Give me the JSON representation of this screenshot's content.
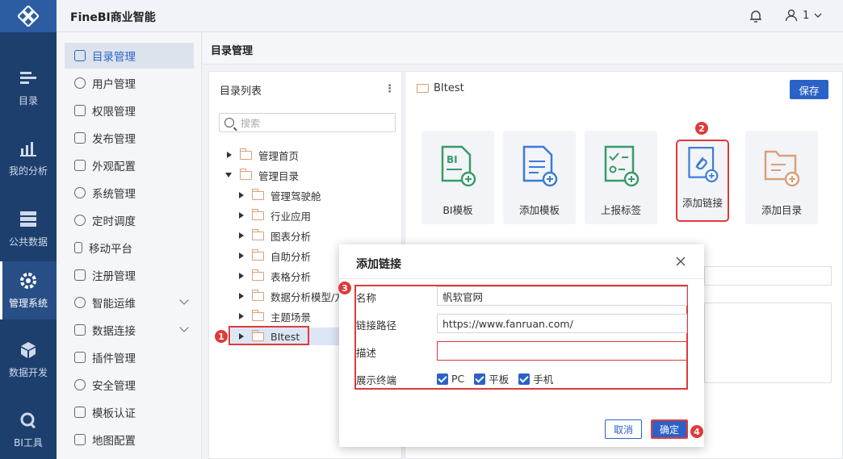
{
  "app": {
    "title": "FineBI商业智能",
    "user": "1"
  },
  "rail": [
    {
      "label": "目录",
      "icon": "catalog-icon"
    },
    {
      "label": "我的分析",
      "icon": "analysis-icon"
    },
    {
      "label": "公共数据",
      "icon": "data-icon"
    },
    {
      "label": "管理系统",
      "icon": "gear-icon",
      "active": true
    },
    {
      "label": "数据开发",
      "icon": "cube-icon"
    },
    {
      "label": "BI工具",
      "icon": "tool-icon"
    }
  ],
  "menu": [
    {
      "label": "目录管理",
      "active": true
    },
    {
      "label": "用户管理"
    },
    {
      "label": "权限管理"
    },
    {
      "label": "发布管理"
    },
    {
      "label": "外观配置"
    },
    {
      "label": "系统管理"
    },
    {
      "label": "定时调度"
    },
    {
      "label": "移动平台"
    },
    {
      "label": "注册管理"
    },
    {
      "label": "智能运维",
      "expandable": true
    },
    {
      "label": "数据连接",
      "expandable": true
    },
    {
      "label": "插件管理"
    },
    {
      "label": "安全管理"
    },
    {
      "label": "模板认证"
    },
    {
      "label": "地图配置"
    }
  ],
  "content": {
    "title": "目录管理",
    "list_title": "目录列表",
    "more": "⋮",
    "search_placeholder": "搜索",
    "tree": [
      {
        "label": "管理首页",
        "level": 0,
        "expanded": false
      },
      {
        "label": "管理目录",
        "level": 0,
        "expanded": true
      },
      {
        "label": "管理驾驶舱",
        "level": 1
      },
      {
        "label": "行业应用",
        "level": 1
      },
      {
        "label": "图表分析",
        "level": 1
      },
      {
        "label": "自助分析",
        "level": 1
      },
      {
        "label": "表格分析",
        "level": 1
      },
      {
        "label": "数据分析模型/方",
        "level": 1
      },
      {
        "label": "主题场景",
        "level": 1
      },
      {
        "label": "BItest",
        "level": 1,
        "selected": true
      }
    ],
    "selected_folder": "BItest",
    "save_label": "保存",
    "cards": [
      {
        "label": "BI模板",
        "color": "#3a9a6a"
      },
      {
        "label": "添加模板",
        "color": "#3a7bd5"
      },
      {
        "label": "上报标签",
        "color": "#3a9a6a"
      },
      {
        "label": "添加链接",
        "color": "#3a7bd5"
      },
      {
        "label": "添加目录",
        "color": "#d9a07a"
      }
    ]
  },
  "dialog": {
    "title": "添加链接",
    "name_label": "名称",
    "name_value": "帆软官网",
    "url_label": "链接路径",
    "url_value": "https://www.fanruan.com/",
    "desc_label": "描述",
    "desc_value": "",
    "terminal_label": "展示终端",
    "terminals": [
      "PC",
      "平板",
      "手机"
    ],
    "cancel_label": "取消",
    "ok_label": "确定"
  },
  "badges": [
    "1",
    "2",
    "3",
    "4"
  ],
  "colors": {
    "accent": "#2b62c8",
    "rail": "#1d3f6e",
    "highlight": "#e03a3a"
  }
}
